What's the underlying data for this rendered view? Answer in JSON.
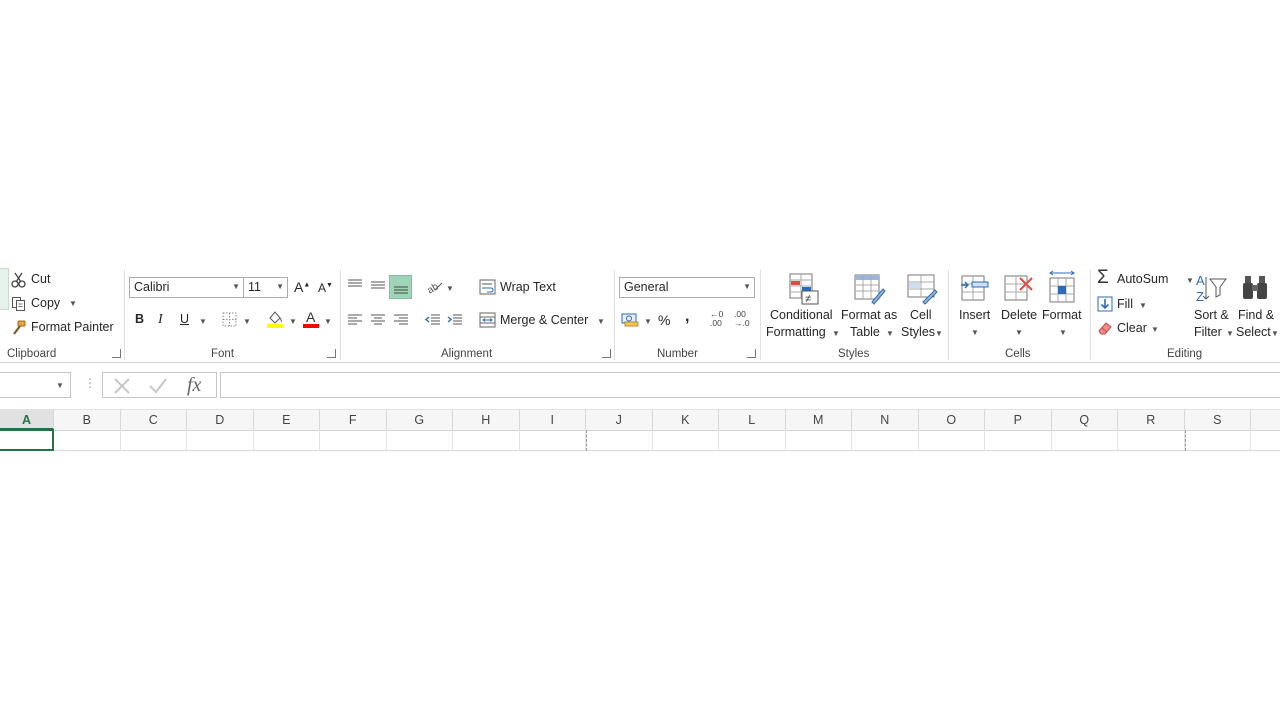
{
  "ribbon": {
    "clipboard": {
      "label": "Clipboard",
      "cut": "Cut",
      "copy": "Copy",
      "format_painter": "Format Painter"
    },
    "font": {
      "label": "Font",
      "font_name": "Calibri",
      "font_size": "11",
      "bold": "B",
      "italic": "I",
      "underline": "U"
    },
    "alignment": {
      "label": "Alignment",
      "wrap_text": "Wrap Text",
      "merge_center": "Merge & Center"
    },
    "number": {
      "label": "Number",
      "format": "General",
      "percent": "%",
      "comma": ",",
      "inc_decimal_top": "←0",
      "inc_decimal_bottom": ".00",
      "dec_decimal_top": ".00",
      "dec_decimal_bottom": "→.0"
    },
    "styles": {
      "label": "Styles",
      "conditional_line1": "Conditional",
      "conditional_line2": "Formatting",
      "format_table_line1": "Format as",
      "format_table_line2": "Table",
      "cell_styles_line1": "Cell",
      "cell_styles_line2": "Styles"
    },
    "cells": {
      "label": "Cells",
      "insert": "Insert",
      "delete": "Delete",
      "format": "Format"
    },
    "editing": {
      "label": "Editing",
      "autosum": "AutoSum",
      "fill": "Fill",
      "clear": "Clear",
      "sort_line1": "Sort &",
      "sort_line2": "Filter",
      "find_line1": "Find &",
      "find_line2": "Select"
    }
  },
  "formula_bar": {
    "fx": "fx",
    "name_box": "",
    "formula": ""
  },
  "grid": {
    "columns": [
      "A",
      "B",
      "C",
      "D",
      "E",
      "F",
      "G",
      "H",
      "I",
      "J",
      "K",
      "L",
      "M",
      "N",
      "O",
      "P",
      "Q",
      "R",
      "S"
    ],
    "selected_column": "A"
  },
  "colors": {
    "accent": "#217346",
    "highlight_yellow": "#ffff00",
    "font_red": "#ff0000"
  }
}
